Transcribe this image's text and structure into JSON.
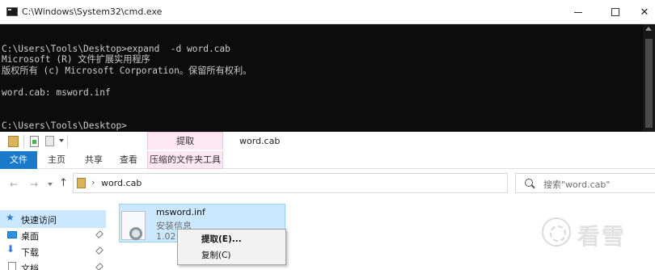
{
  "cmd": {
    "title": "C:\\Windows\\System32\\cmd.exe",
    "console_text": "\nC:\\Users\\Tools\\Desktop>expand  -d word.cab\nMicrosoft (R) 文件扩展实用程序\n版权所有 (c) Microsoft Corporation。保留所有权利。\n\nword.cab: msword.inf\n\n\nC:\\Users\\Tools\\Desktop>"
  },
  "explorer": {
    "window_title": "word.cab",
    "context_tab_group": "提取",
    "ribbon_tabs": [
      "文件",
      "主页",
      "共享",
      "查看",
      "压缩的文件夹工具"
    ],
    "address": {
      "path_segment": "word.cab"
    },
    "search": {
      "placeholder": "搜索\"word.cab\""
    },
    "nav_pane": {
      "items": [
        {
          "label": "快速访问",
          "icon": "star-icon"
        },
        {
          "label": "桌面",
          "icon": "desktop-icon"
        },
        {
          "label": "下载",
          "icon": "download-icon"
        },
        {
          "label": "文档",
          "icon": "document-icon"
        }
      ]
    },
    "file": {
      "name": "msword.inf",
      "type": "安装信息",
      "size": "1.02 K"
    },
    "context_menu": {
      "items": [
        "提取(E)...",
        "复制(C)"
      ]
    }
  },
  "watermark": {
    "text": "看雪"
  },
  "colors": {
    "console_bg": "#0c0c0c",
    "console_text": "#cccccc",
    "file_tab_blue": "#1979ca",
    "selection_blue": "#cce8ff",
    "context_tab_pink": "#fde7f2"
  }
}
